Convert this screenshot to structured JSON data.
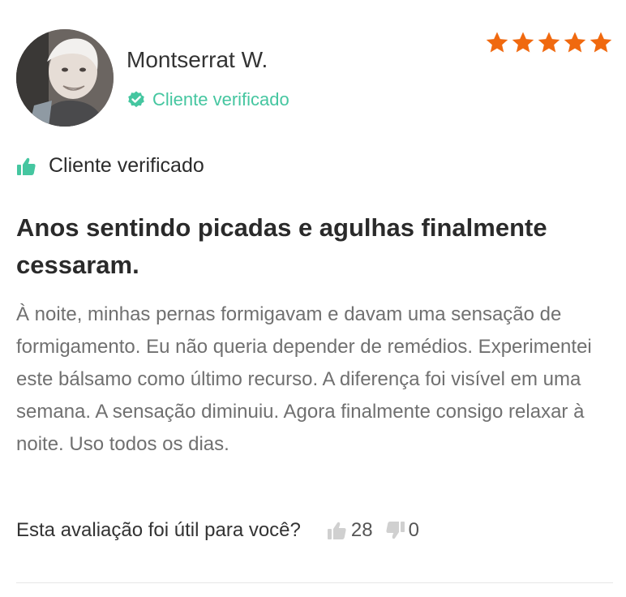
{
  "review": {
    "author_name": "Montserrat W.",
    "verified_label": "Cliente verificado",
    "rating": 5,
    "rating_max": 5,
    "recommend_label": "Cliente verificado",
    "title": "Anos sentindo picadas e agulhas finalmente cessaram.",
    "body": "À noite, minhas pernas formigavam e davam uma sensação de formigamento. Eu não queria depender de remédios. Experimentei este bálsamo como último recurso. A diferença foi visível em uma semana. A sensação diminuiu. Agora finalmente consigo relaxar à noite. Uso todos os dias.",
    "helpful_question": "Esta avaliação foi útil para você?",
    "upvotes": "28",
    "downvotes": "0"
  },
  "colors": {
    "star": "#f0690f",
    "verified": "#45c6a0",
    "thumb_up_recommend": "#45c6a0",
    "vote_icon": "#d0d0d0"
  },
  "icons": {
    "verified": "check-badge-icon",
    "star": "star-icon",
    "recommend": "thumbs-up-icon",
    "upvote": "thumbs-up-icon",
    "downvote": "thumbs-down-icon"
  }
}
